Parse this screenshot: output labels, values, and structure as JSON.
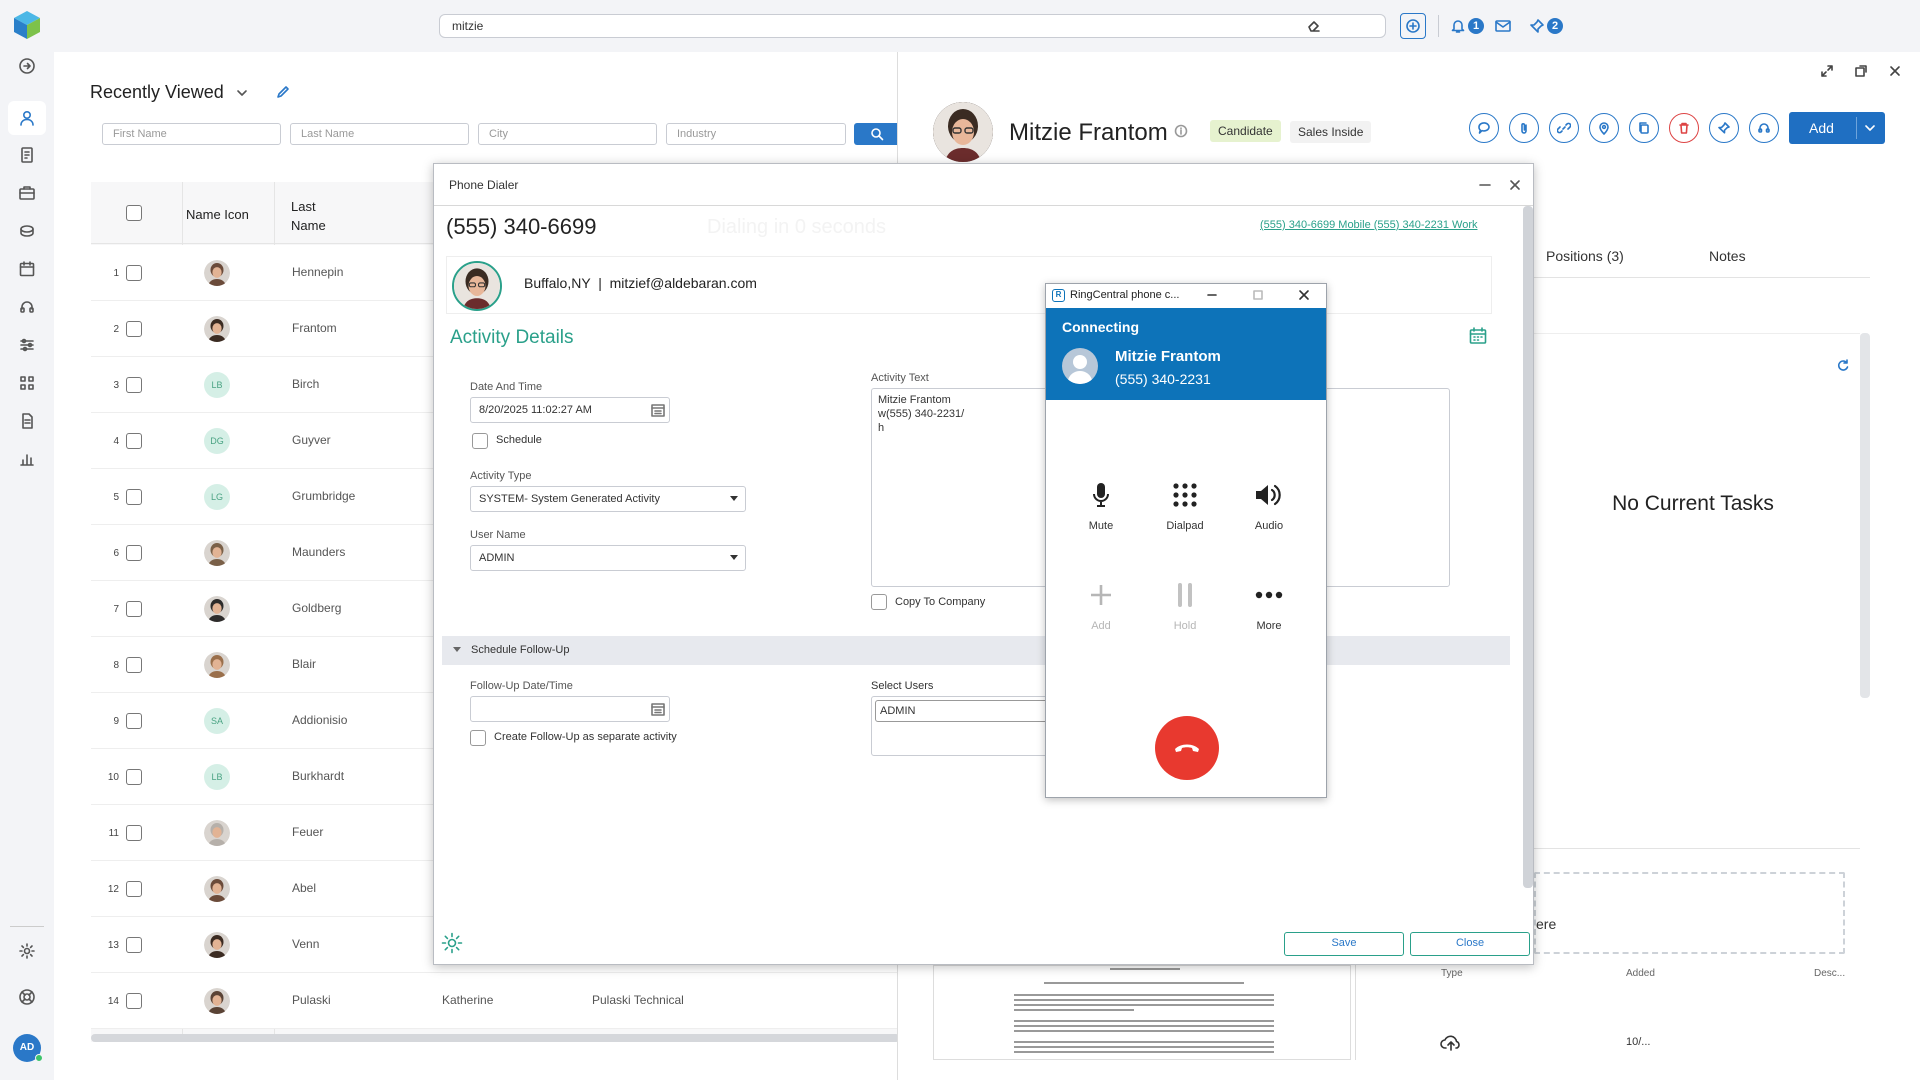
{
  "topbar": {
    "search_value": "mitzie",
    "notifications_count": "1",
    "pins_count": "2"
  },
  "list": {
    "title": "Recently Viewed",
    "filters": {
      "first_name": "First Name",
      "last_name": "Last Name",
      "city": "City",
      "industry": "Industry"
    },
    "columns": {
      "name_icon": "Name Icon",
      "last_name_line1": "Last",
      "last_name_line2": "Name"
    },
    "rows": [
      {
        "num": "1",
        "last": "Hennepin",
        "avatar": "photo"
      },
      {
        "num": "2",
        "last": "Frantom",
        "avatar": "photo"
      },
      {
        "num": "3",
        "last": "Birch",
        "initials": "LB"
      },
      {
        "num": "4",
        "last": "Guyver",
        "initials": "DG"
      },
      {
        "num": "5",
        "last": "Grumbridge",
        "initials": "LG"
      },
      {
        "num": "6",
        "last": "Maunders",
        "avatar": "photo"
      },
      {
        "num": "7",
        "last": "Goldberg",
        "avatar": "photo"
      },
      {
        "num": "8",
        "last": "Blair",
        "avatar": "photo"
      },
      {
        "num": "9",
        "last": "Addionisio",
        "initials": "SA"
      },
      {
        "num": "10",
        "last": "Burkhardt",
        "initials": "LB"
      },
      {
        "num": "11",
        "last": "Feuer",
        "avatar": "photo"
      },
      {
        "num": "12",
        "last": "Abel",
        "avatar": "photo"
      },
      {
        "num": "13",
        "last": "Venn",
        "avatar": "photo"
      },
      {
        "num": "14",
        "last": "Pulaski",
        "first": "Katherine",
        "company": "Pulaski Technical",
        "avatar": "photo"
      }
    ]
  },
  "record": {
    "name": "Mitzie Frantom",
    "tag_candidate": "Candidate",
    "tag_sales": "Sales Inside",
    "add_label": "Add",
    "tab_positions": "Positions (3)",
    "tab_notes": "Notes",
    "no_tasks": "No Current Tasks",
    "drop_text": "ere",
    "docs_columns": {
      "type": "Type",
      "added": "Added",
      "desc": "Desc..."
    },
    "doc_added": "10/..."
  },
  "dialer": {
    "title": "Phone Dialer",
    "number": "(555) 340-6699",
    "dialing_text": "Dialing in 0 seconds",
    "links": "(555) 340-6699 Mobile (555) 340-2231 Work",
    "location": "Buffalo,NY",
    "email": "mitzief@aldebaran.com",
    "section_title": "Activity Details",
    "date_label": "Date And Time",
    "date_value": "8/20/2025 11:02:27 AM",
    "schedule_label": "Schedule",
    "activity_type_label": "Activity Type",
    "activity_type_value": "SYSTEM- System Generated Activity",
    "user_name_label": "User Name",
    "user_name_value": "ADMIN",
    "activity_text_label": "Activity Text",
    "activity_text_line1": "Mitzie Frantom",
    "activity_text_line2": "w(555) 340-2231/",
    "activity_text_line3": "h",
    "copy_company_label": "Copy To Company",
    "followup_section": "Schedule Follow-Up",
    "followup_date_label": "Follow-Up Date/Time",
    "separate_activity_label": "Create Follow-Up as separate activity",
    "select_users_label": "Select Users",
    "select_users_value": "ADMIN",
    "save_label": "Save",
    "close_label": "Close"
  },
  "ringcentral": {
    "title": "RingCentral phone c...",
    "status": "Connecting",
    "contact_name": "Mitzie Frantom",
    "contact_number": "(555) 340-2231",
    "mute": "Mute",
    "dialpad": "Dialpad",
    "audio": "Audio",
    "add": "Add",
    "hold": "Hold",
    "more": "More",
    "accent_color": "#0d73b9",
    "hangup_color": "#e8392f"
  },
  "user": {
    "initials": "AD"
  }
}
